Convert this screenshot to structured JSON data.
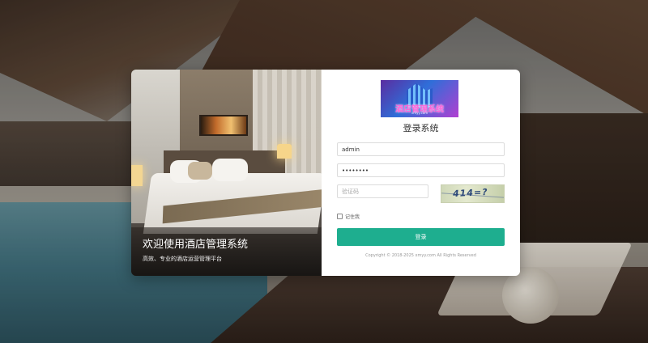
{
  "caption": {
    "title": "欢迎使用酒店管理系统",
    "subtitle": "高效、专业的酒店运营管理平台"
  },
  "logo": {
    "text": "酒店管理系统",
    "subtext": "xmyy.com"
  },
  "form": {
    "title": "登录系统",
    "username_value": "admin",
    "password_value": "password",
    "code_placeholder": "验证码",
    "captcha_text": "414=?",
    "remember_label": "记住我",
    "submit_label": "登录",
    "copyright": "Copyright © 2018-2025 xmyy.com All Rights Reserved"
  },
  "colors": {
    "accent": "#1eae8f"
  }
}
